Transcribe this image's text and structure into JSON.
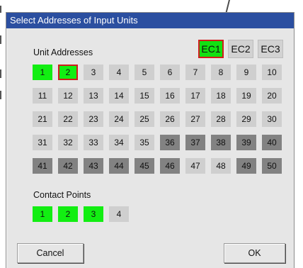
{
  "dialog": {
    "title": "Select Addresses of Input Units",
    "ec_buttons": [
      {
        "label": "EC1",
        "selected": true
      },
      {
        "label": "EC2",
        "selected": false
      },
      {
        "label": "EC3",
        "selected": false
      }
    ],
    "unit_addresses": {
      "label": "Unit Addresses",
      "rows": [
        [
          {
            "n": "1",
            "s": "green"
          },
          {
            "n": "2",
            "s": "green-selected"
          },
          {
            "n": "3",
            "s": "light"
          },
          {
            "n": "4",
            "s": "light"
          },
          {
            "n": "5",
            "s": "light"
          },
          {
            "n": "6",
            "s": "light"
          },
          {
            "n": "7",
            "s": "light"
          },
          {
            "n": "8",
            "s": "light"
          },
          {
            "n": "9",
            "s": "light"
          },
          {
            "n": "10",
            "s": "light"
          }
        ],
        [
          {
            "n": "11",
            "s": "light"
          },
          {
            "n": "12",
            "s": "light"
          },
          {
            "n": "13",
            "s": "light"
          },
          {
            "n": "14",
            "s": "light"
          },
          {
            "n": "15",
            "s": "light"
          },
          {
            "n": "16",
            "s": "light"
          },
          {
            "n": "17",
            "s": "light"
          },
          {
            "n": "18",
            "s": "light"
          },
          {
            "n": "19",
            "s": "light"
          },
          {
            "n": "20",
            "s": "light"
          }
        ],
        [
          {
            "n": "21",
            "s": "light"
          },
          {
            "n": "22",
            "s": "light"
          },
          {
            "n": "23",
            "s": "light"
          },
          {
            "n": "24",
            "s": "light"
          },
          {
            "n": "25",
            "s": "light"
          },
          {
            "n": "26",
            "s": "light"
          },
          {
            "n": "27",
            "s": "light"
          },
          {
            "n": "28",
            "s": "light"
          },
          {
            "n": "29",
            "s": "light"
          },
          {
            "n": "30",
            "s": "light"
          }
        ],
        [
          {
            "n": "31",
            "s": "light"
          },
          {
            "n": "32",
            "s": "light"
          },
          {
            "n": "33",
            "s": "light"
          },
          {
            "n": "34",
            "s": "light"
          },
          {
            "n": "35",
            "s": "light"
          },
          {
            "n": "36",
            "s": "dark"
          },
          {
            "n": "37",
            "s": "dark"
          },
          {
            "n": "38",
            "s": "dark"
          },
          {
            "n": "39",
            "s": "dark"
          },
          {
            "n": "40",
            "s": "dark"
          }
        ],
        [
          {
            "n": "41",
            "s": "dark"
          },
          {
            "n": "42",
            "s": "dark"
          },
          {
            "n": "43",
            "s": "dark"
          },
          {
            "n": "44",
            "s": "dark"
          },
          {
            "n": "45",
            "s": "dark"
          },
          {
            "n": "46",
            "s": "dark"
          },
          {
            "n": "47",
            "s": "light"
          },
          {
            "n": "48",
            "s": "light"
          },
          {
            "n": "49",
            "s": "dark"
          },
          {
            "n": "50",
            "s": "dark"
          }
        ]
      ]
    },
    "contact_points": {
      "label": "Contact Points",
      "items": [
        {
          "n": "1",
          "s": "green"
        },
        {
          "n": "2",
          "s": "green"
        },
        {
          "n": "3",
          "s": "green"
        },
        {
          "n": "4",
          "s": "light"
        }
      ]
    },
    "cancel_label": "Cancel",
    "ok_label": "OK"
  },
  "colors": {
    "titlebar": "#2b4fa0",
    "active_green": "#12ee12",
    "selection_red": "#d01c1c",
    "inactive_light": "#cfcfcf",
    "inactive_dark": "#828282"
  }
}
